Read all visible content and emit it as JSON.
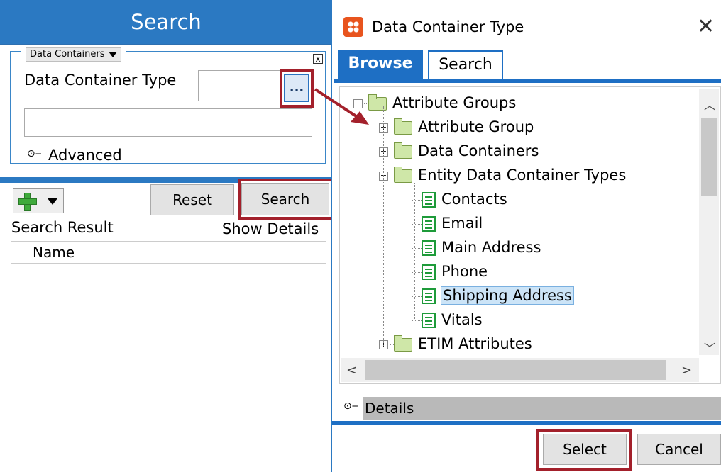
{
  "left": {
    "title": "Search",
    "group_selector": "Data Containers",
    "group_close": "x",
    "dct_label": "Data Container Type",
    "browse_button": "...",
    "advanced_label": "Advanced",
    "reset_button": "Reset",
    "search_button": "Search",
    "search_result_label": "Search Result",
    "show_details_link": "Show Details",
    "name_column": "Name"
  },
  "dialog": {
    "title": "Data Container Type",
    "close": "✕",
    "tabs": [
      "Browse",
      "Search"
    ],
    "tree": [
      {
        "label": "Attribute Groups",
        "level": 0,
        "expander": "⊟",
        "icon": "folder-icon"
      },
      {
        "label": "Attribute Group",
        "level": 1,
        "expander": "⊞",
        "icon": "folder-icon"
      },
      {
        "label": "Data Containers",
        "level": 1,
        "expander": "⊞",
        "icon": "folder-icon"
      },
      {
        "label": "Entity Data Container Types",
        "level": 1,
        "expander": "⊟",
        "icon": "folder-icon"
      },
      {
        "label": "Contacts",
        "level": 2,
        "icon": "document-icon"
      },
      {
        "label": "Email",
        "level": 2,
        "icon": "document-icon"
      },
      {
        "label": "Main Address",
        "level": 2,
        "icon": "document-icon"
      },
      {
        "label": "Phone",
        "level": 2,
        "icon": "document-icon"
      },
      {
        "label": "Shipping Address",
        "level": 2,
        "icon": "document-icon",
        "selected": true
      },
      {
        "label": "Vitals",
        "level": 2,
        "icon": "document-icon"
      },
      {
        "label": "ETIM Attributes",
        "level": 1,
        "expander": "⊞",
        "icon": "folder-icon"
      }
    ],
    "details_label": "Details",
    "select_button": "Select",
    "cancel_button": "Cancel"
  },
  "colors": {
    "accent": "#2b79c2",
    "highlight_box": "#a3202b",
    "selection": "#cce4f7"
  }
}
